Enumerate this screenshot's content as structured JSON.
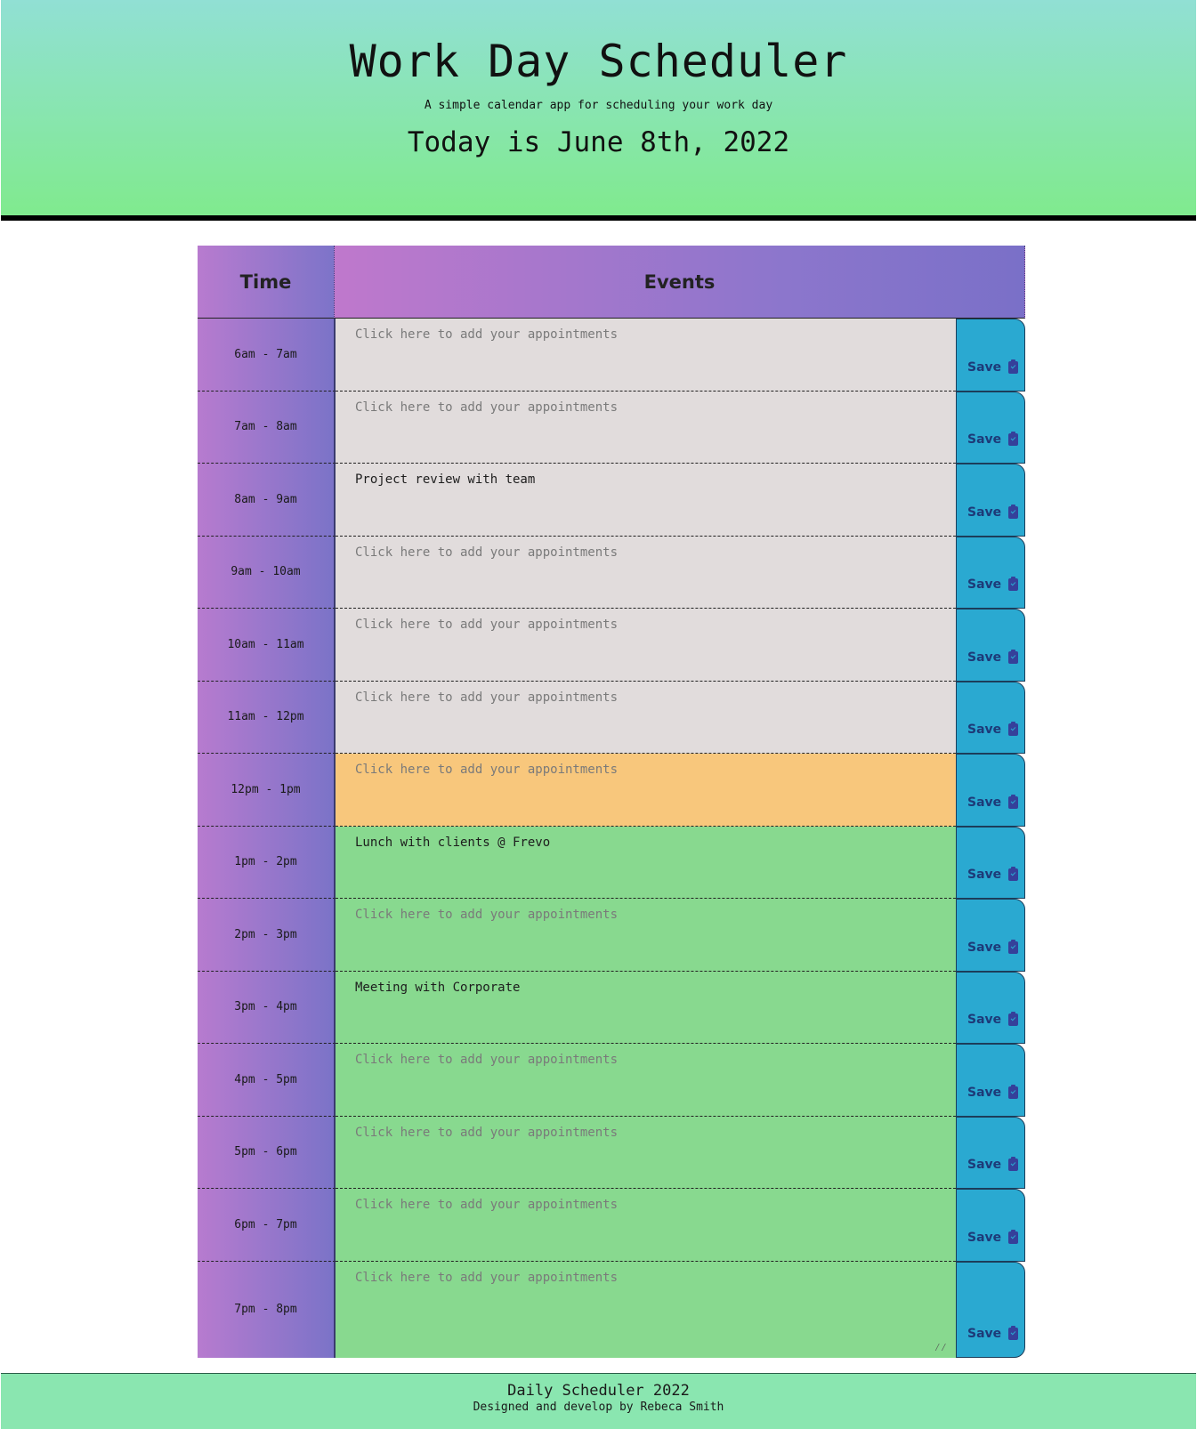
{
  "header": {
    "title": "Work Day Scheduler",
    "subtitle": "A simple calendar app for scheduling your work day",
    "current_date": "Today is June 8th, 2022"
  },
  "table": {
    "time_header": "Time",
    "events_header": "Events",
    "placeholder": "Click here to add your appointments",
    "save_label": "Save"
  },
  "rows": [
    {
      "time": "6am - 7am",
      "event": "",
      "status": "past"
    },
    {
      "time": "7am - 8am",
      "event": "",
      "status": "past"
    },
    {
      "time": "8am - 9am",
      "event": "Project review with team",
      "status": "past"
    },
    {
      "time": "9am - 10am",
      "event": "",
      "status": "past"
    },
    {
      "time": "10am - 11am",
      "event": "",
      "status": "past"
    },
    {
      "time": "11am - 12pm",
      "event": "",
      "status": "past"
    },
    {
      "time": "12pm - 1pm",
      "event": "",
      "status": "present"
    },
    {
      "time": "1pm - 2pm",
      "event": "Lunch with clients @ Frevo",
      "status": "future"
    },
    {
      "time": "2pm - 3pm",
      "event": "",
      "status": "future"
    },
    {
      "time": "3pm - 4pm",
      "event": "Meeting with Corporate",
      "status": "future"
    },
    {
      "time": "4pm - 5pm",
      "event": "",
      "status": "future"
    },
    {
      "time": "5pm - 6pm",
      "event": "",
      "status": "future"
    },
    {
      "time": "6pm - 7pm",
      "event": "",
      "status": "future"
    },
    {
      "time": "7pm - 8pm",
      "event": "",
      "status": "future"
    }
  ],
  "colors": {
    "past": "#e1dcdc",
    "present": "#f8c77c",
    "future": "#88d98f",
    "save_button": "#2aa9d1"
  },
  "icons": {
    "save": "clipboard-check-icon",
    "resize": "resize-handle-icon"
  },
  "footer": {
    "title": "Daily Scheduler 2022",
    "credit": "Designed and develop by Rebeca Smith"
  }
}
